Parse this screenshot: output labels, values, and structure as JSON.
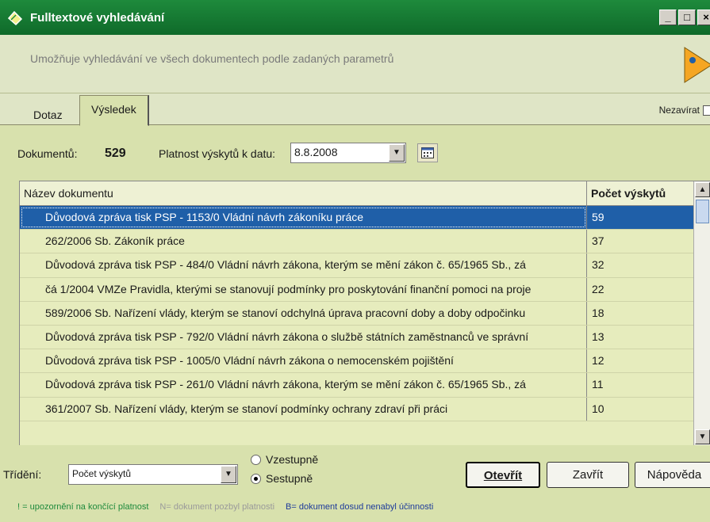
{
  "window": {
    "title": "Fulltextové vyhledávání",
    "controls": [
      "_",
      "□",
      "×"
    ]
  },
  "info": {
    "description": "Umožňuje vyhledávání ve všech dokumentech podle zadaných parametrů"
  },
  "tabs": [
    {
      "label": "Dotaz",
      "active": false
    },
    {
      "label": "Výsledek",
      "active": true
    }
  ],
  "nezavirat": {
    "label": "Nezavírat",
    "checked": false
  },
  "filter": {
    "documents_label": "Dokumentů:",
    "documents_count": "529",
    "validity_label": "Platnost výskytů k datu:",
    "date_value": "8.8.2008"
  },
  "grid": {
    "col_name": "Název dokumentu",
    "col_count": "Počet výskytů",
    "rows": [
      {
        "name": "Důvodová zpráva tisk PSP - 1153/0 Vládní návrh zákoníku práce",
        "count": "59",
        "selected": true
      },
      {
        "name": "262/2006 Sb. Zákoník práce",
        "count": "37"
      },
      {
        "name": "Důvodová zpráva tisk PSP - 484/0 Vládní návrh zákona, kterým se mění zákon č. 65/1965 Sb., zá",
        "count": "32"
      },
      {
        "name": "čá 1/2004 VMZe Pravidla, kterými se stanovují podmínky pro poskytování finanční pomoci na proje",
        "count": "22"
      },
      {
        "name": "589/2006 Sb. Nařízení vlády, kterým se stanoví odchylná úprava pracovní doby a doby odpočinku",
        "count": "18"
      },
      {
        "name": "Důvodová zpráva tisk PSP - 792/0 Vládní návrh zákona o službě státních zaměstnanců ve správní",
        "count": "13"
      },
      {
        "name": "Důvodová zpráva tisk PSP - 1005/0 Vládní návrh zákona o nemocenském pojištění",
        "count": "12"
      },
      {
        "name": "Důvodová zpráva tisk PSP - 261/0 Vládní návrh zákona, kterým se mění zákon č. 65/1965 Sb., zá",
        "count": "11"
      },
      {
        "name": "361/2007 Sb. Nařízení vlády, kterým se stanoví podmínky ochrany zdraví při práci",
        "count": "10"
      }
    ]
  },
  "sort": {
    "label": "Třídění:",
    "value": "Počet výskytů",
    "asc_label": "Vzestupně",
    "desc_label": "Sestupně",
    "selected": "desc"
  },
  "buttons": {
    "open": "Otevřít",
    "close": "Zavřít",
    "help": "Nápověda"
  },
  "legend": {
    "warning": "! = upozornění na končící platnost",
    "expired": "N= dokument pozbyl platnosti",
    "pending": "B= dokument dosud nenabyl účinnosti"
  },
  "colors": {
    "title_bar": "#1e8a3c",
    "background": "#d8e1ad",
    "selection": "#1f5fa8",
    "legend_green": "#1e8a3c",
    "legend_blue": "#1d3a9a"
  }
}
